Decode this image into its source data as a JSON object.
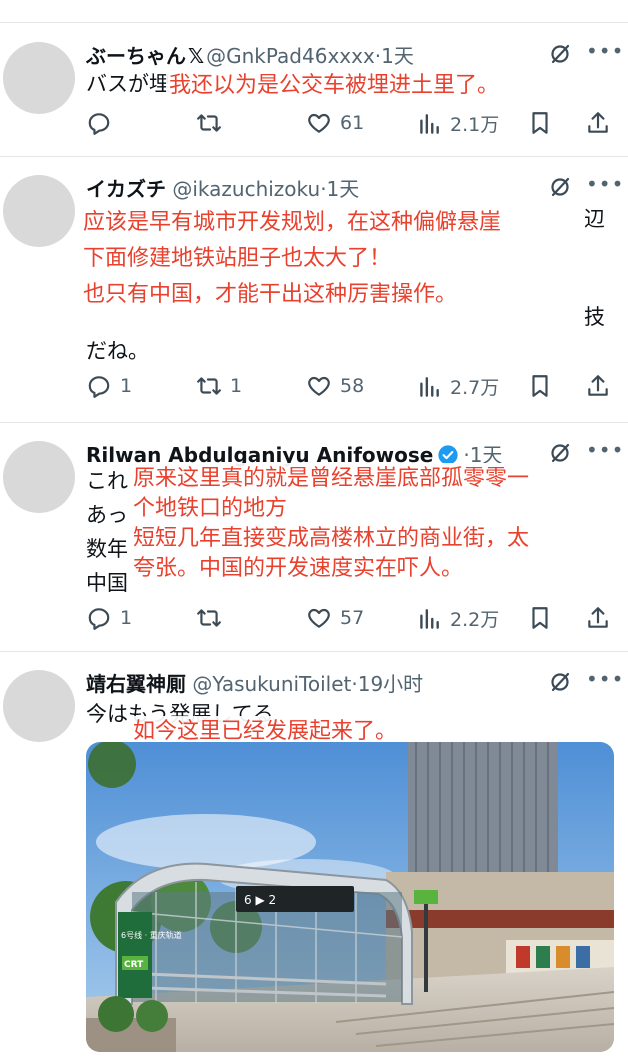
{
  "tweets": [
    {
      "name": "ぶーちゃん",
      "handle": "@GnkPad46xxxx",
      "time": "·1天",
      "body": "バスが埋",
      "overlay": "我还以为是公交车被埋进土里了。",
      "replies": "",
      "retweets": "",
      "likes": "61",
      "views": "2.1万"
    },
    {
      "name": "イカズチ",
      "handle": "@ikazuchizoku",
      "time": "·1天",
      "body_last": "だね。",
      "edge_chars": [
        "辺",
        "技"
      ],
      "overlay": [
        "应该是早有城市开发规划，在这种偏僻悬崖",
        "下面修建地铁站胆子也太大了！",
        "也只有中国，才能干出这种厉害操作。"
      ],
      "replies": "1",
      "retweets": "1",
      "likes": "58",
      "views": "2.7万"
    },
    {
      "name": "Rilwan Abdulganiyu Anifowose",
      "handle": "",
      "time": "·1天",
      "body_lines": [
        "これ",
        "あっ",
        "数年",
        "中国"
      ],
      "overlay": [
        "原来这里真的就是曾经悬崖底部孤零零一",
        "个地铁口的地方",
        "短短几年直接变成高楼林立的商业街，太",
        "夸张。中国的开发速度实在吓人。"
      ],
      "replies": "1",
      "retweets": "",
      "likes": "57",
      "views": "2.2万"
    },
    {
      "name": "靖右翼神厠",
      "handle": "@YasukuniToilet",
      "time": "·19小时",
      "body": "今はもう発展してる",
      "overlay": "如今这里已经发展起来了。"
    }
  ],
  "photo": {
    "sign_line": "6号线 · 重庆轨道",
    "sign_brand": "CRT",
    "station_sign": "6  ▶  2"
  },
  "icons": [
    "x-logo-icon",
    "verified-icon",
    "grok-slash-icon",
    "more-icon",
    "reply-icon",
    "retweet-icon",
    "like-icon",
    "views-icon",
    "bookmark-icon",
    "share-icon"
  ],
  "colors": {
    "overlay_text": "#e8412e",
    "verified": "#1d9bf0",
    "secondary": "#536471"
  }
}
